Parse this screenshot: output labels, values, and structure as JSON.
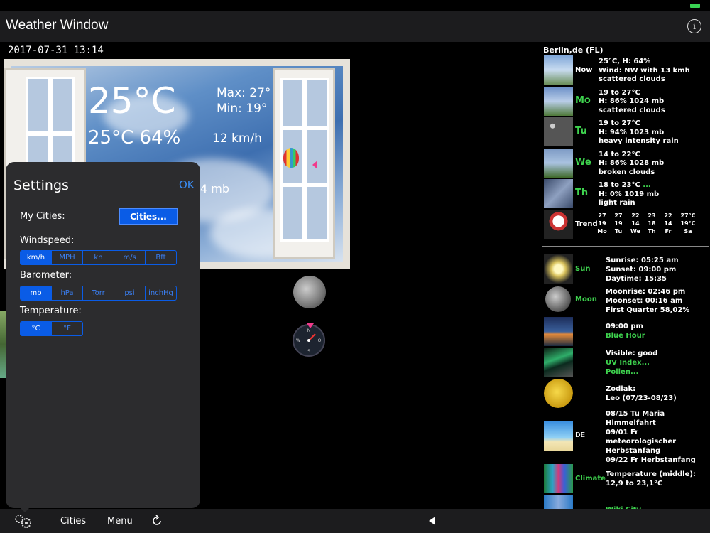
{
  "app": {
    "title": "Weather Window",
    "datetime": "2017-07-31 13:14"
  },
  "icons": {
    "info": "info-icon",
    "settings": "settings-gears-icon",
    "refresh": "refresh-icon",
    "back": "back-triangle-icon"
  },
  "current": {
    "temp": "25°C",
    "feels": "25°C 64%",
    "max": "Max: 27°",
    "min": "Min: 19°",
    "wind": "12 km/h",
    "pressure": "4 mb"
  },
  "settings": {
    "title": "Settings",
    "ok": "OK",
    "my_cities_label": "My Cities:",
    "cities_button": "Cities...",
    "windspeed_label": "Windspeed:",
    "windspeed_options": [
      "km/h",
      "MPH",
      "kn",
      "m/s",
      "Bft"
    ],
    "windspeed_selected": 0,
    "barometer_label": "Barometer:",
    "barometer_options": [
      "mb",
      "hPa",
      "Torr",
      "psi",
      "inchHg"
    ],
    "barometer_selected": 0,
    "temperature_label": "Temperature:",
    "temperature_options": [
      "°C",
      "°F"
    ],
    "temperature_selected": 0
  },
  "forecast": {
    "city": "Berlin,de (FL)",
    "rows": [
      {
        "label": "Now",
        "lines": [
          "25°C, H: 64%",
          "Wind: NW with 13 kmh",
          "scattered clouds"
        ]
      },
      {
        "label": "Mo",
        "lines": [
          "19 to 27°C",
          "H: 86% 1024 mb",
          "scattered clouds"
        ]
      },
      {
        "label": "Tu",
        "lines": [
          "19 to 27°C",
          "H: 94% 1023 mb",
          "heavy intensity rain"
        ]
      },
      {
        "label": "We",
        "lines": [
          "14 to 22°C",
          "H: 86% 1028 mb",
          "broken clouds"
        ]
      },
      {
        "label": "Th",
        "lines": [
          "18 to 23°C",
          "H: 0% 1019 mb",
          "light rain"
        ],
        "more": "..."
      }
    ],
    "trend": {
      "label": "Trend",
      "cols": [
        {
          "hi": "27",
          "lo": "19",
          "day": "Mo"
        },
        {
          "hi": "27",
          "lo": "19",
          "day": "Tu"
        },
        {
          "hi": "22",
          "lo": "14",
          "day": "We"
        },
        {
          "hi": "23",
          "lo": "18",
          "day": "Th"
        },
        {
          "hi": "22",
          "lo": "14",
          "day": "Fr"
        },
        {
          "hi": "27°C",
          "lo": "19°C",
          "day": "Sa"
        }
      ]
    }
  },
  "astro": {
    "sun": {
      "label": "Sun",
      "lines": [
        "Sunrise: 05:25 am",
        "Sunset: 09:00 pm",
        "Daytime: 15:35"
      ]
    },
    "moon": {
      "label": "Moon",
      "lines": [
        "Moonrise: 02:46 pm",
        "Moonset: 00:16 am",
        "First Quarter 58,02%"
      ]
    },
    "bluehour": {
      "time": "09:00 pm",
      "label": "Blue Hour"
    },
    "aurora": {
      "visible": "Visible: good",
      "uv": "UV Index...",
      "pollen": "Pollen..."
    },
    "zodiac": {
      "title": "Zodiak:",
      "value": "Leo (07/23-08/23)"
    },
    "holidays": {
      "country": "DE",
      "lines": [
        "08/15 Tu Maria",
        "Himmelfahrt",
        "09/01 Fr",
        "meteorologischer",
        "Herbstanfang",
        "09/22 Fr Herbstanfang"
      ]
    },
    "climate": {
      "label": "Climate",
      "lines": [
        "Temperature (middle):",
        "12,9 to 23,1°C"
      ]
    },
    "wiki": {
      "label": "Wiki City"
    }
  },
  "bottombar": {
    "cities": "Cities",
    "menu": "Menu"
  }
}
